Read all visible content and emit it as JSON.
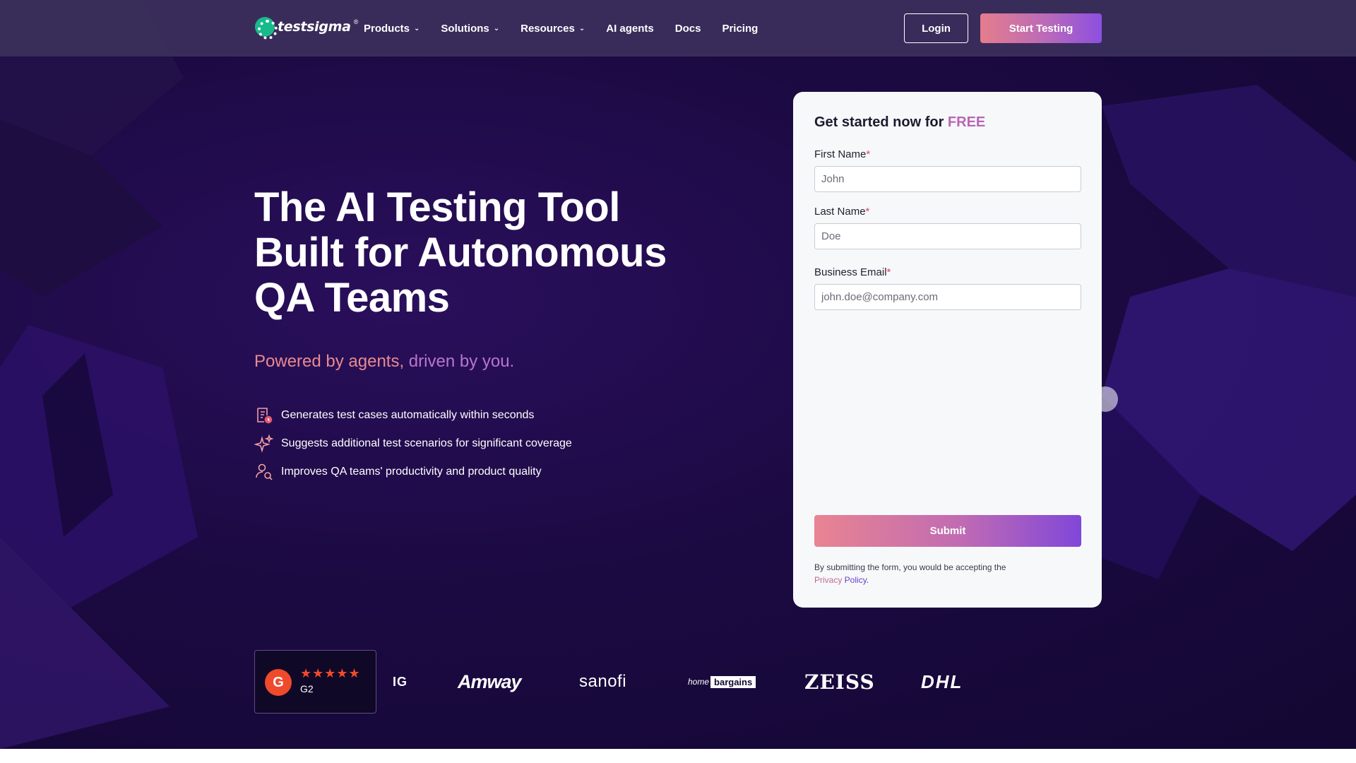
{
  "nav": {
    "logo_text": "testsigma",
    "logo_reg": "®",
    "menu": [
      {
        "label": "Products",
        "has_dropdown": true
      },
      {
        "label": "Solutions",
        "has_dropdown": true
      },
      {
        "label": "Resources",
        "has_dropdown": true
      },
      {
        "label": "AI agents",
        "has_dropdown": false
      },
      {
        "label": "Docs",
        "has_dropdown": false
      },
      {
        "label": "Pricing",
        "has_dropdown": false
      }
    ],
    "login_label": "Login",
    "start_label": "Start Testing"
  },
  "hero": {
    "title": "The AI Testing Tool Built for Autonomous QA Teams",
    "subtitle_part1": "Powered by agents,",
    "subtitle_part2": " driven by you.",
    "features": [
      {
        "icon": "document-clock-icon",
        "text": "Generates test cases automatically within seconds"
      },
      {
        "icon": "sparkles-icon",
        "text": "Suggests additional test scenarios for significant coverage"
      },
      {
        "icon": "user-search-icon",
        "text": "Improves QA teams' productivity and product quality"
      }
    ]
  },
  "form": {
    "title_prefix": "Get started now for ",
    "title_free": "FREE",
    "first_name_label": "First Name",
    "first_name_placeholder": "John",
    "last_name_label": "Last Name",
    "last_name_placeholder": "Doe",
    "email_label": "Business Email",
    "email_placeholder": "john.doe@company.com",
    "required_mark": "*",
    "submit_label": "Submit",
    "disclaimer": "By submitting the form, you would be accepting the",
    "privacy_part1": "Privacy",
    "privacy_part2": " Policy",
    "period": "."
  },
  "logos": {
    "g2_badge": "G",
    "g2_stars": "★★★★★",
    "g2_label": "G2",
    "brands": [
      "IG",
      "Amway",
      "sanofi",
      "home",
      "bargains",
      "ZEISS",
      "DHL"
    ]
  },
  "colors": {
    "background": "#1a0a3d",
    "accent_pink": "#e98a8f",
    "accent_purple": "#8c4fe0",
    "g2_red": "#ef4a2b"
  }
}
